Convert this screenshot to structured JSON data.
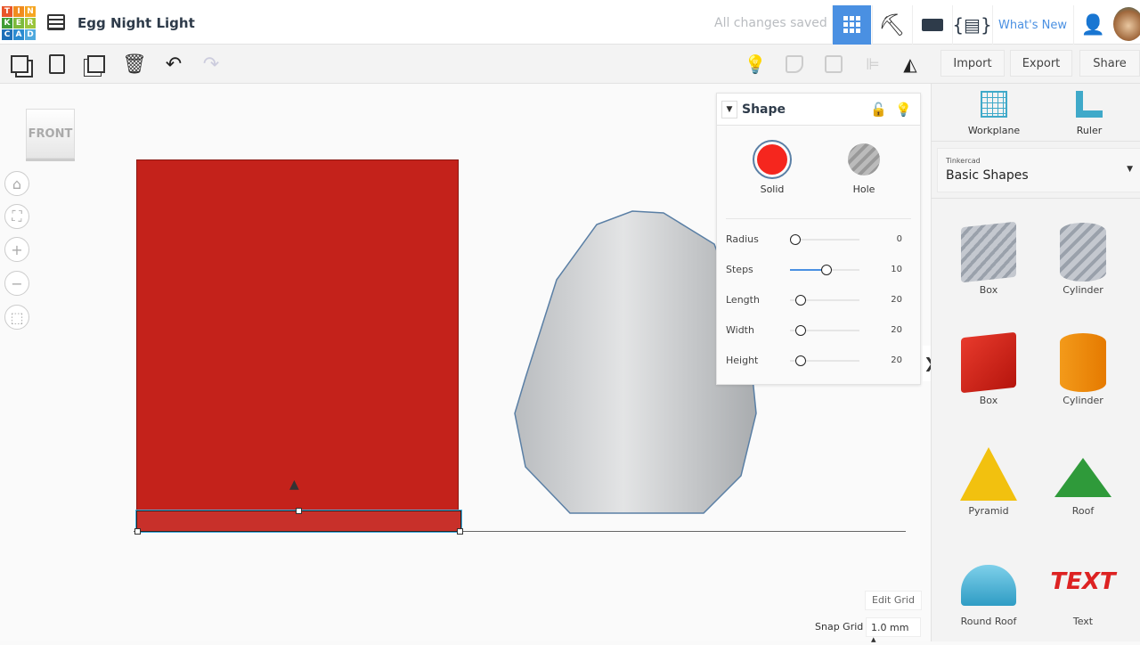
{
  "header": {
    "logo_letters": [
      "T",
      "I",
      "N",
      "K",
      "E",
      "R",
      "C",
      "A",
      "D"
    ],
    "title": "Egg Night Light",
    "status": "All changes saved",
    "whats_new": "What's New"
  },
  "toolbar": {
    "import": "Import",
    "export": "Export",
    "share": "Share"
  },
  "view_cube": {
    "label": "FRONT"
  },
  "inspector": {
    "title": "Shape",
    "solid": "Solid",
    "hole": "Hole",
    "params": [
      {
        "label": "Radius",
        "value": "0",
        "fraction": 0
      },
      {
        "label": "Steps",
        "value": "10",
        "fraction": 0.45
      },
      {
        "label": "Length",
        "value": "20",
        "fraction": 0.08
      },
      {
        "label": "Width",
        "value": "20",
        "fraction": 0.08
      },
      {
        "label": "Height",
        "value": "20",
        "fraction": 0.08
      }
    ]
  },
  "right_panel": {
    "workplane": "Workplane",
    "ruler": "Ruler",
    "library_source": "Tinkercad",
    "library_name": "Basic Shapes",
    "shapes": [
      "Box",
      "Cylinder",
      "Box",
      "Cylinder",
      "Pyramid",
      "Roof",
      "Round Roof",
      "Text"
    ]
  },
  "grid": {
    "edit": "Edit Grid",
    "snap_label": "Snap Grid",
    "snap_value": "1.0 mm"
  },
  "colors": {
    "accent": "#4a90e2",
    "solid": "#c4221b"
  }
}
